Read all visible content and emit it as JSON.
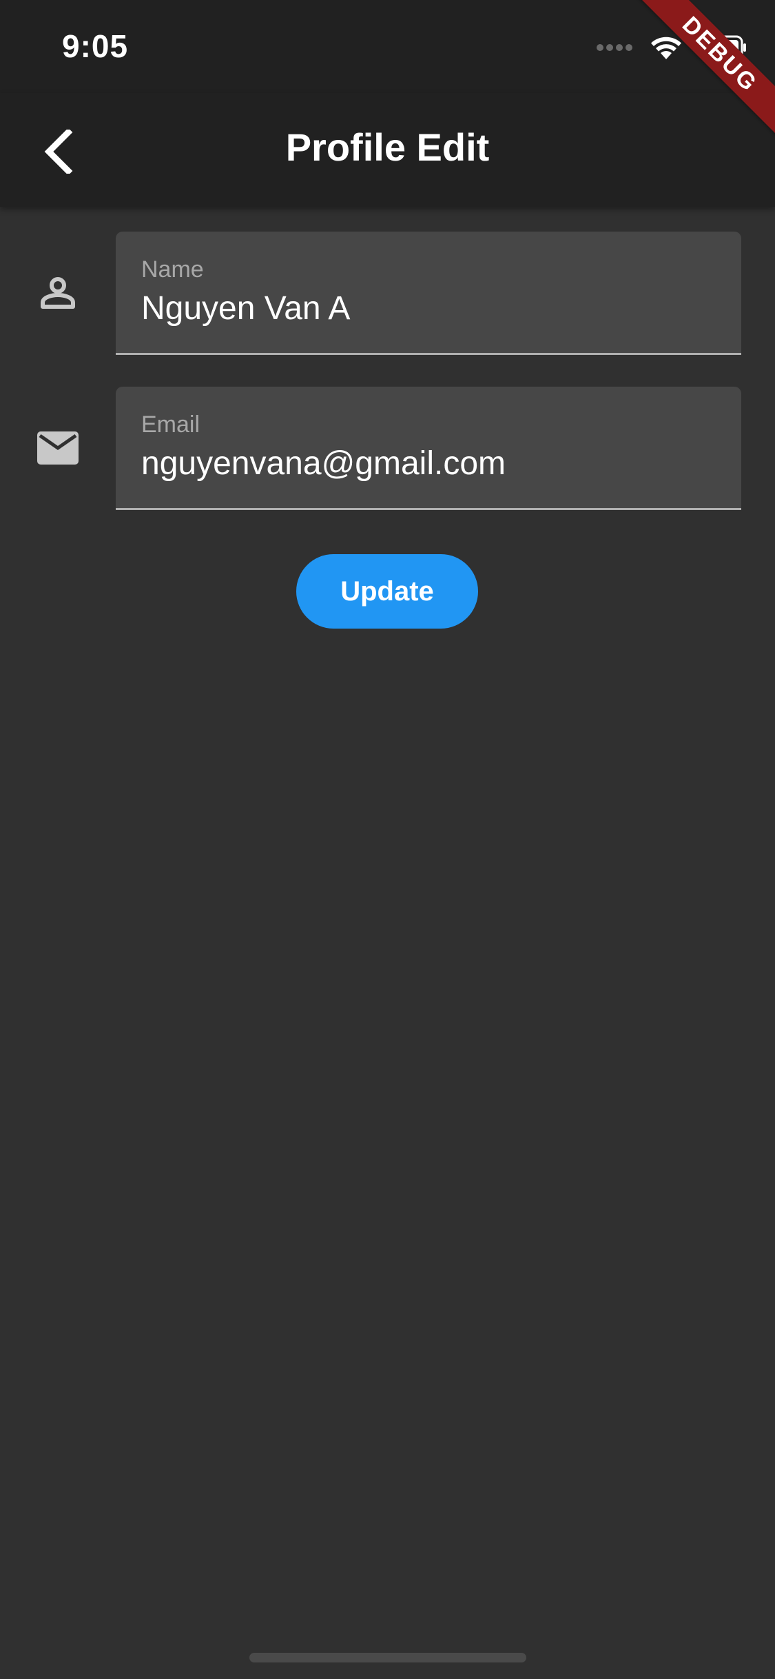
{
  "status_bar": {
    "time": "9:05"
  },
  "debug_banner": {
    "label": "DEBUG"
  },
  "app_bar": {
    "title": "Profile Edit",
    "back_icon": "chevron-left-icon"
  },
  "form": {
    "name": {
      "icon": "person-icon",
      "label": "Name",
      "value": "Nguyen Van A"
    },
    "email": {
      "icon": "mail-icon",
      "label": "Email",
      "value": "nguyenvana@gmail.com"
    }
  },
  "actions": {
    "update_label": "Update"
  },
  "colors": {
    "background": "#303030",
    "app_bar": "#212121",
    "field_fill": "#474747",
    "accent": "#2196f3",
    "debug_ribbon": "#8b1a1a"
  }
}
